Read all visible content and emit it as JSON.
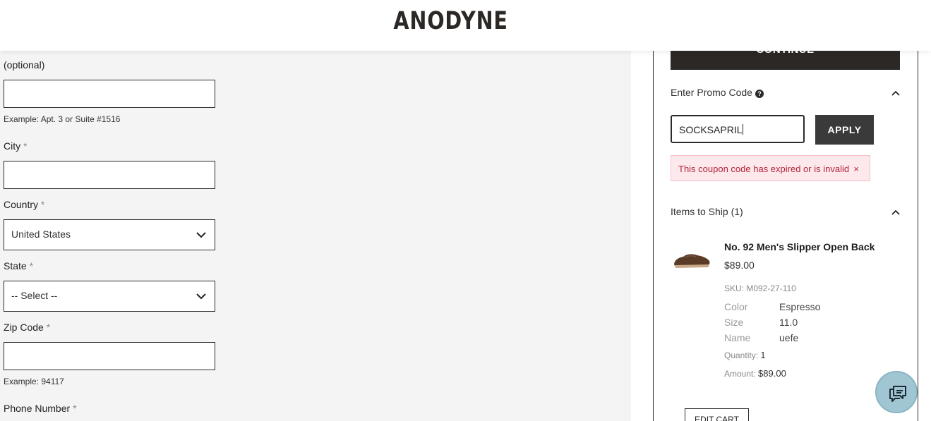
{
  "header": {
    "logo": "ANODYNE"
  },
  "form": {
    "address2_label": "(optional)",
    "address2_value": "",
    "address2_hint": "Example: Apt. 3 or Suite #1516",
    "city_label": "City",
    "city_value": "",
    "country_label": "Country",
    "country_value": "United States",
    "state_label": "State",
    "state_value": "-- Select --",
    "zip_label": "Zip Code",
    "zip_value": "",
    "zip_hint": "Example: 94117",
    "phone_label": "Phone Number",
    "required_mark": "*"
  },
  "summary": {
    "continue_label": "CONTINUE",
    "promo": {
      "title": "Enter Promo Code",
      "help_icon": "?",
      "value": "SOCKSAPRIL",
      "apply_label": "APPLY",
      "error": "This coupon code has expired or is invalid",
      "error_close": "×"
    },
    "items_title": "Items to Ship (1)",
    "item": {
      "name": "No. 92 Men's Slipper Open Back",
      "price": "$89.00",
      "sku": "SKU: M092-27-110",
      "attributes": [
        {
          "key": "Color",
          "value": "Espresso"
        },
        {
          "key": "Size",
          "value": "11.0"
        },
        {
          "key": "Name",
          "value": "uefe"
        }
      ],
      "quantity_label": "Quantity:",
      "quantity_value": "1",
      "amount_label": "Amount:",
      "amount_value": "$89.00"
    },
    "edit_cart_label": "EDIT CART"
  },
  "icons": {
    "chevron": "chevron-down-icon",
    "chevron_up": "chevron-up-icon",
    "help": "question-circle-icon",
    "chat": "chat-bubble-icon"
  }
}
